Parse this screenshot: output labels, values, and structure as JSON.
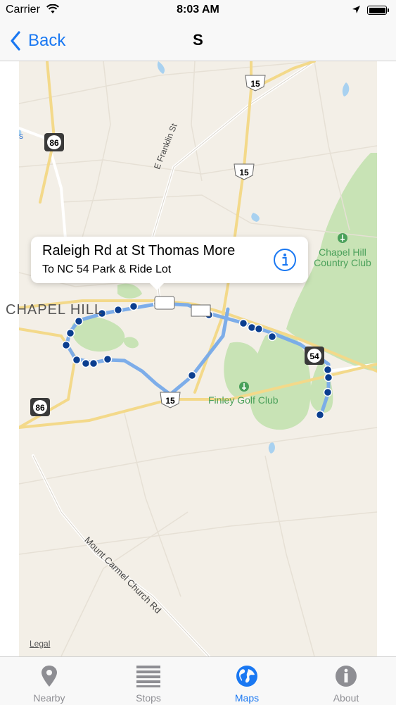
{
  "status_bar": {
    "carrier": "Carrier",
    "time": "8:03 AM",
    "icons": [
      "wifi-icon",
      "location-arrow-icon",
      "battery-icon"
    ]
  },
  "nav": {
    "back_label": "Back",
    "title": "S"
  },
  "map": {
    "labels": {
      "chapel_hill": "CHAPEL HILL",
      "chapel_hill_cc": "Chapel Hill Country Club",
      "finley_golf": "Finley Golf Club",
      "e_franklin": "E Franklin St",
      "mount_carmel": "Mount Carmel Church Rd",
      "shield_86": "86",
      "shield_15": "15",
      "shield_54": "54",
      "edge_s": "s"
    },
    "legal": "Legal",
    "colors": {
      "background": "#f3efe7",
      "park": "#c8e3b5",
      "water": "#a8d1f0",
      "road_major": "#f3d98a",
      "route": "#77aaea",
      "stop": "#0b3e8f"
    }
  },
  "callout": {
    "title": "Raleigh Rd at St Thomas More",
    "subtitle": "To NC 54 Park & Ride Lot"
  },
  "tabs": [
    {
      "label": "Nearby",
      "icon": "map-pin-icon",
      "active": false
    },
    {
      "label": "Stops",
      "icon": "list-icon",
      "active": false
    },
    {
      "label": "Maps",
      "icon": "globe-icon",
      "active": true
    },
    {
      "label": "About",
      "icon": "info-icon",
      "active": false
    }
  ]
}
